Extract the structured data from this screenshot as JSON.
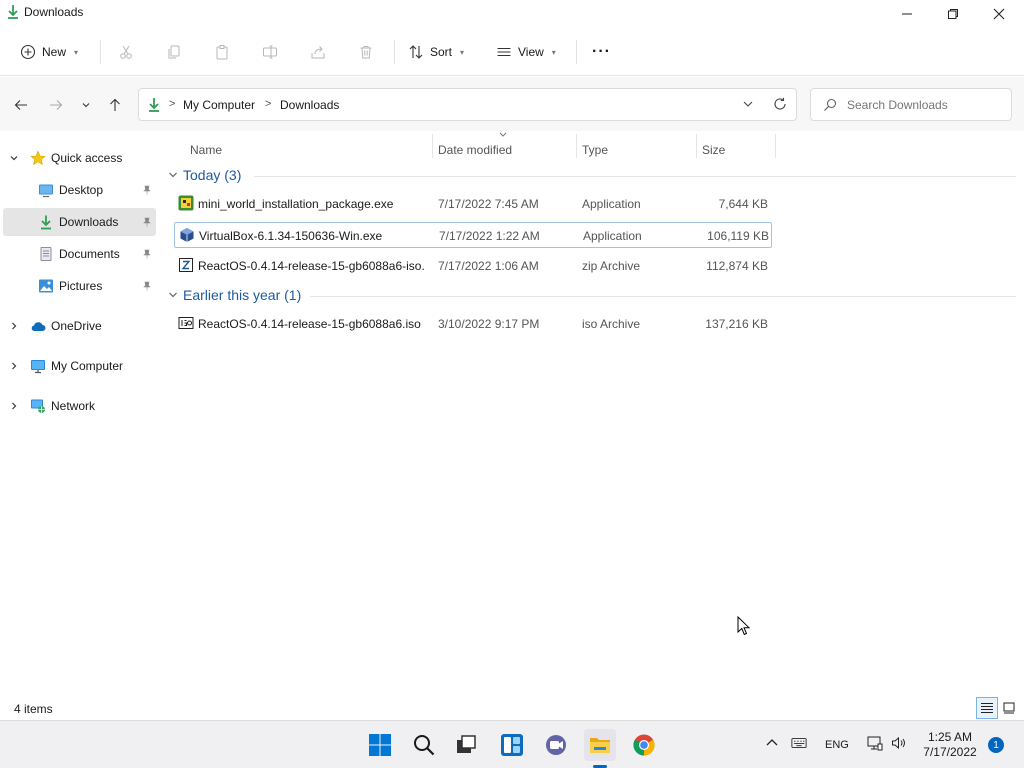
{
  "window": {
    "title": "Downloads",
    "colors": {
      "accent": "#0067c0",
      "folder_green": "#2e9e55",
      "group_header": "#1e5aa0"
    }
  },
  "commandbar": {
    "new_label": "New",
    "sort_label": "Sort",
    "view_label": "View",
    "more_label": "···"
  },
  "address": {
    "crumbs": [
      "My Computer",
      "Downloads"
    ],
    "search_placeholder": "Search Downloads"
  },
  "sidebar": {
    "items": [
      {
        "label": "Quick access",
        "icon": "star-icon"
      },
      {
        "label": "Desktop",
        "icon": "desktop-icon"
      },
      {
        "label": "Downloads",
        "icon": "download-icon"
      },
      {
        "label": "Documents",
        "icon": "document-icon"
      },
      {
        "label": "Pictures",
        "icon": "pictures-icon"
      },
      {
        "label": "OneDrive",
        "icon": "cloud-icon"
      },
      {
        "label": "My Computer",
        "icon": "computer-icon"
      },
      {
        "label": "Network",
        "icon": "network-icon"
      }
    ]
  },
  "columns": {
    "name": "Name",
    "date": "Date modified",
    "type": "Type",
    "size": "Size"
  },
  "groups": [
    {
      "title": "Today (3)",
      "files": [
        {
          "name": "mini_world_installation_package.exe",
          "date": "7/17/2022 7:45 AM",
          "type": "Application",
          "size": "7,644 KB",
          "icon": "mini-world-app-icon"
        },
        {
          "name": "VirtualBox-6.1.34-150636-Win.exe",
          "date": "7/17/2022 1:22 AM",
          "type": "Application",
          "size": "106,119 KB",
          "icon": "virtualbox-icon"
        },
        {
          "name": "ReactOS-0.4.14-release-15-gb6088a6-iso....",
          "date": "7/17/2022 1:06 AM",
          "type": "zip Archive",
          "size": "112,874 KB",
          "icon": "zip-archive-icon"
        }
      ]
    },
    {
      "title": "Earlier this year (1)",
      "files": [
        {
          "name": "ReactOS-0.4.14-release-15-gb6088a6.iso",
          "date": "3/10/2022 9:17 PM",
          "type": "iso Archive",
          "size": "137,216 KB",
          "icon": "iso-archive-icon"
        }
      ]
    }
  ],
  "status": {
    "item_count": "4 items"
  },
  "taskbar": {
    "language": "ENG",
    "time": "1:25 AM",
    "date": "7/17/2022",
    "notification_count": "1"
  }
}
